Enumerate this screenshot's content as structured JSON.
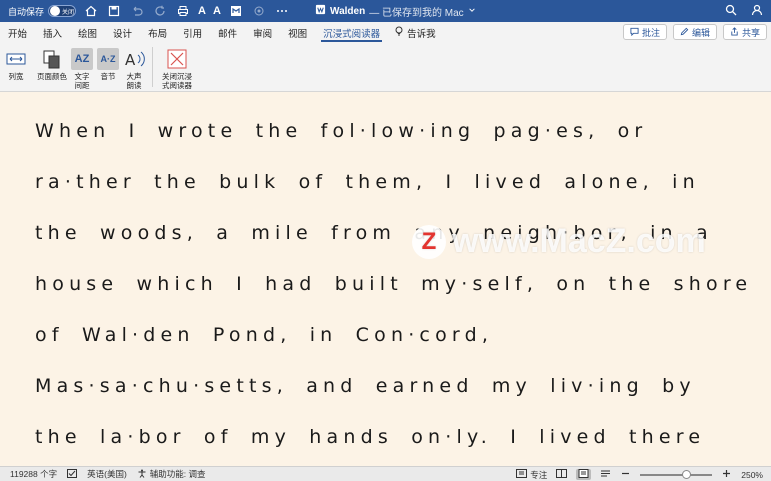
{
  "titlebar": {
    "autosave_label": "自动保存",
    "autosave_state": "关闭",
    "doc_name": "Walden",
    "doc_status": "— 已保存到我的 Mac",
    "accent": "#2b579a"
  },
  "tabs": [
    {
      "label": "开始"
    },
    {
      "label": "插入"
    },
    {
      "label": "绘图"
    },
    {
      "label": "设计"
    },
    {
      "label": "布局"
    },
    {
      "label": "引用"
    },
    {
      "label": "邮件"
    },
    {
      "label": "审阅"
    },
    {
      "label": "视图"
    },
    {
      "label": "沉浸式阅读器",
      "active": true
    }
  ],
  "tell_me": "告诉我",
  "ribbon_buttons": {
    "comments": "批注",
    "edit": "编辑",
    "share": "共享"
  },
  "toolbar": {
    "column_width": "列宽",
    "page_color": "页面颜色",
    "text_spacing": "文字\n间距",
    "syllables": "音节",
    "read_aloud": "大声\n朗读",
    "close": "关闭沉浸\n式阅读器"
  },
  "document": {
    "lines": [
      "When I wrote the fol·low·ing pag·es, or",
      "ra·ther the bulk of them, I lived alone, in",
      "the woods, a mile from any neigh·bor, in a",
      "house which I had built my·self, on the shore",
      "of Wal·den Pond, in Con·cord,",
      "Mas·sa·chu·setts, and earned my liv·ing by",
      "the la·bor of my hands on·ly. I lived there"
    ]
  },
  "watermark": {
    "logo": "Z",
    "text": "www.MacZ.com"
  },
  "statusbar": {
    "word_count": "119288 个字",
    "language": "英语(美国)",
    "accessibility": "辅助功能: 调查",
    "focus": "专注",
    "zoom": "250%"
  }
}
